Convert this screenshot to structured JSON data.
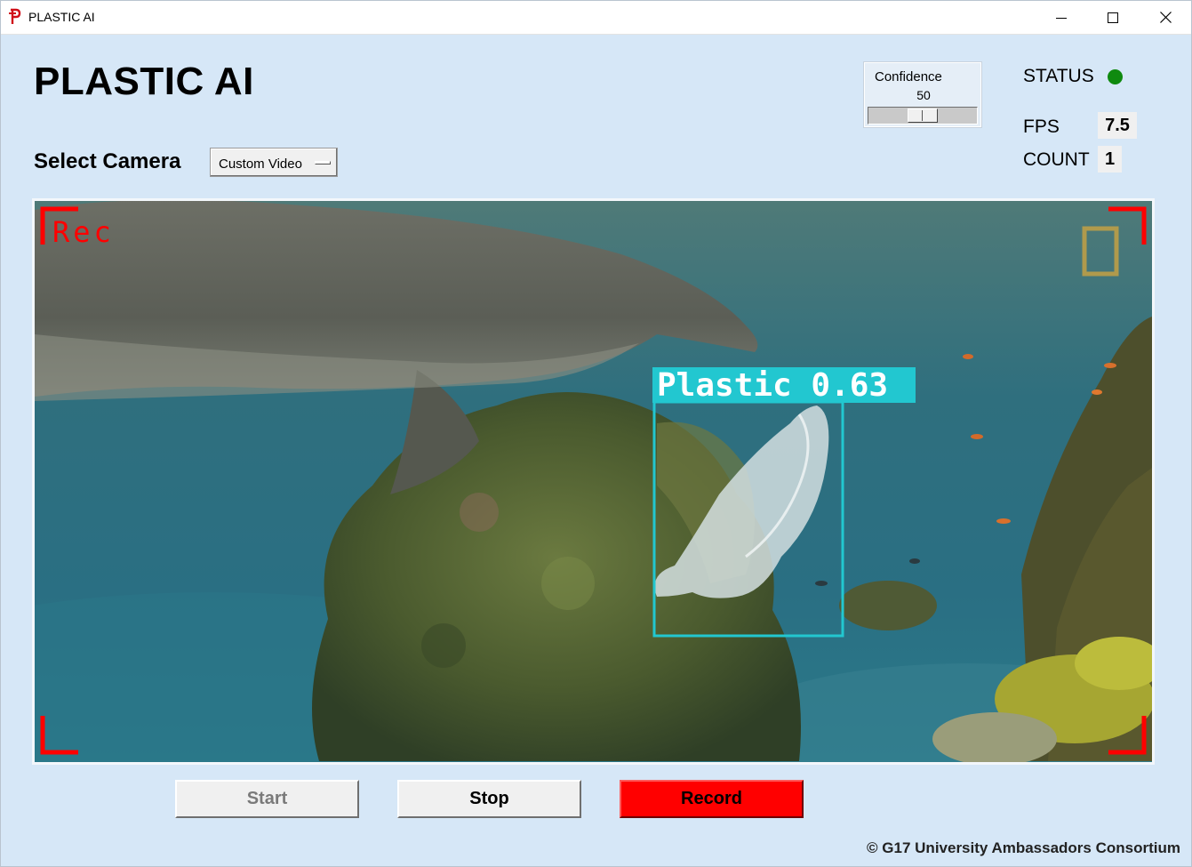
{
  "window": {
    "title": "PLASTIC AI"
  },
  "header": {
    "app_title": "PLASTIC AI"
  },
  "camera": {
    "label": "Select Camera",
    "selected": "Custom Video"
  },
  "confidence": {
    "label": "Confidence",
    "value": "50",
    "slider_fraction": 0.5
  },
  "stats": {
    "status_label": "STATUS",
    "status_color": "#0f8a0f",
    "fps_label": "FPS",
    "fps_value": "7.5",
    "count_label": "COUNT",
    "count_value": "1"
  },
  "video": {
    "rec_text": "Rec",
    "rec_color": "#ff0000",
    "detection_label": "Plastic 0.63",
    "detection_color": "#22c7d0"
  },
  "controls": {
    "start_label": "Start",
    "stop_label": "Stop",
    "record_label": "Record",
    "record_color": "#ff0000"
  },
  "footer": {
    "text": "© G17 University Ambassadors Consortium"
  }
}
